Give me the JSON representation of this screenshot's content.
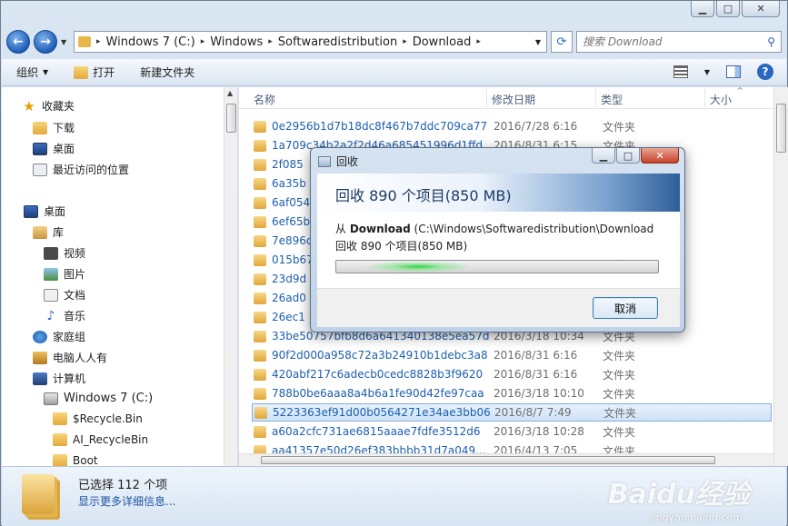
{
  "address": {
    "segments": [
      "Windows 7  (C:)",
      "Windows",
      "Softwaredistribution",
      "Download"
    ],
    "search_placeholder": "搜索 Download"
  },
  "toolbar": {
    "organize": "组织",
    "open": "打开",
    "new_folder": "新建文件夹"
  },
  "nav": {
    "favorites": "收藏夹",
    "downloads": "下载",
    "desktop_fav": "桌面",
    "recent": "最近访问的位置",
    "desktop": "桌面",
    "libraries": "库",
    "videos": "视频",
    "pictures": "图片",
    "documents": "文档",
    "music": "音乐",
    "homegroup": "家庭组",
    "user": "电脑人人有",
    "computer": "计算机",
    "drive_c": "Windows 7   (C:)",
    "f1": "$Recycle.Bin",
    "f2": "AI_RecycleBin",
    "f3": "Boot"
  },
  "columns": {
    "name": "名称",
    "date": "修改日期",
    "type": "类型",
    "size": "大小"
  },
  "rows": [
    {
      "name": "0e2956b1d7b18dc8f467b7ddc709ca77",
      "date": "2016/7/28 6:16",
      "type": "文件夹"
    },
    {
      "name": "1a709c34b2a2f2d46a685451996d1ffd",
      "date": "2016/8/31 6:15",
      "type": "文件夹"
    },
    {
      "name": "2f085",
      "date": "",
      "type": ""
    },
    {
      "name": "6a35b",
      "date": "",
      "type": ""
    },
    {
      "name": "6af054",
      "date": "",
      "type": ""
    },
    {
      "name": "6ef65b",
      "date": "",
      "type": ""
    },
    {
      "name": "7e896c",
      "date": "",
      "type": ""
    },
    {
      "name": "015b67",
      "date": "",
      "type": ""
    },
    {
      "name": "23d9d",
      "date": "",
      "type": ""
    },
    {
      "name": "26ad0",
      "date": "",
      "type": ""
    },
    {
      "name": "26ec1",
      "date": "",
      "type": ""
    },
    {
      "name": "33be50757bfb8d6a641340138e5ea57d",
      "date": "2016/3/18 10:34",
      "type": "文件夹"
    },
    {
      "name": "90f2d000a958c72a3b24910b1debc3a8",
      "date": "2016/8/31 6:16",
      "type": "文件夹"
    },
    {
      "name": "420abf217c6adecb0cedc8828b3f9620",
      "date": "2016/8/31 6:16",
      "type": "文件夹"
    },
    {
      "name": "788b0be6aaa8a4b6a1fe90d42fe97caa",
      "date": "2016/3/18 10:10",
      "type": "文件夹"
    },
    {
      "name": "5223363ef91d00b0564271e34ae3bb06",
      "date": "2016/8/7 7:49",
      "type": "文件夹"
    },
    {
      "name": "a60a2cfc731ae6815aaae7fdfe3512d6",
      "date": "2016/3/18 10:28",
      "type": "文件夹"
    },
    {
      "name": "aa41357e50d26ef383bbbb31d7a049...",
      "date": "2016/4/13 7:05",
      "type": "文件夹"
    }
  ],
  "status": {
    "selected": "已选择 112 个项",
    "more": "显示更多详细信息..."
  },
  "dialog": {
    "title": "回收",
    "header": "回收 890 个项目(850 MB)",
    "from_prefix": "从 ",
    "from_bold": "Download",
    "from_path": " (C:\\Windows\\Softwaredistribution\\Download",
    "line2": "回收 890 个项目(850 MB)",
    "cancel": "取消"
  },
  "watermark": {
    "main": "Baidu经验",
    "sub": "jingyan.baidu.com"
  }
}
